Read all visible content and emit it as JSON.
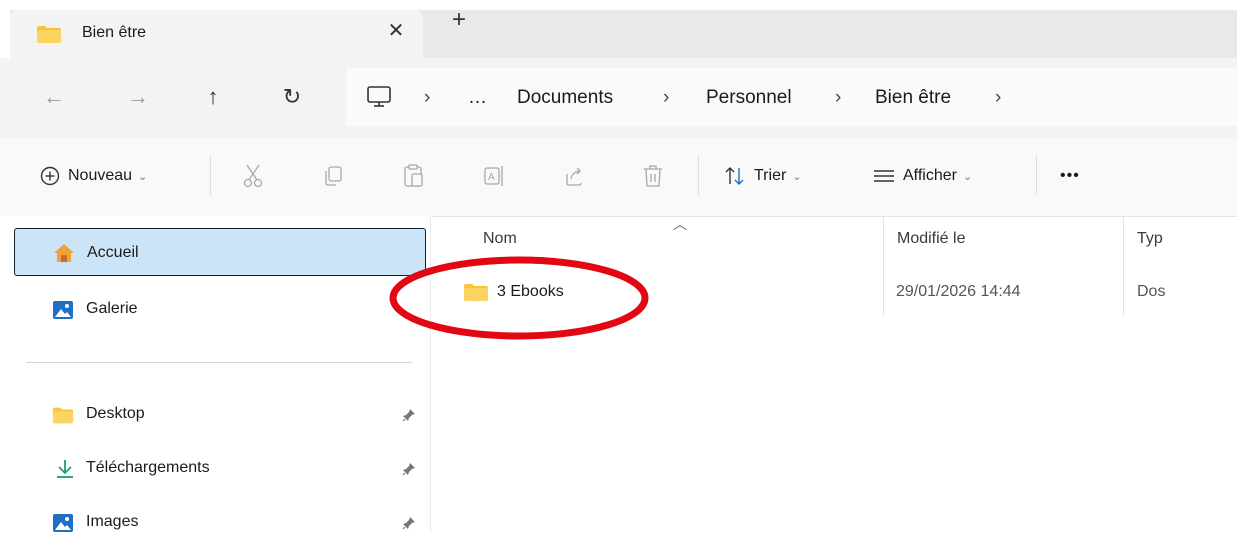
{
  "tab": {
    "title": "Bien être",
    "close": "✕",
    "new": "+"
  },
  "nav": {
    "back": "←",
    "forward": "→",
    "up": "↑",
    "refresh": "↻"
  },
  "address": {
    "overflow": "…",
    "crumbs": [
      "Documents",
      "Personnel",
      "Bien être"
    ],
    "separator": "›"
  },
  "toolbar": {
    "new_label": "Nouveau",
    "sort_label": "Trier",
    "view_label": "Afficher",
    "more_label": "•••",
    "caret": "⌄"
  },
  "sidebar": {
    "items": [
      {
        "label": "Accueil",
        "icon": "home-icon"
      },
      {
        "label": "Galerie",
        "icon": "gallery-icon"
      },
      {
        "label": "Desktop",
        "icon": "folder-icon"
      },
      {
        "label": "Téléchargements",
        "icon": "download-icon"
      },
      {
        "label": "Images",
        "icon": "images-icon"
      }
    ]
  },
  "columns": {
    "name": "Nom",
    "modified": "Modifié le",
    "type": "Typ"
  },
  "files": [
    {
      "name": "3 Ebooks",
      "modified": "29/01/2026 14:44",
      "type": "Dos"
    }
  ],
  "colors": {
    "selected_bg": "#cce4f7",
    "folder": "#f8c43a",
    "annotation": "#e30613"
  }
}
